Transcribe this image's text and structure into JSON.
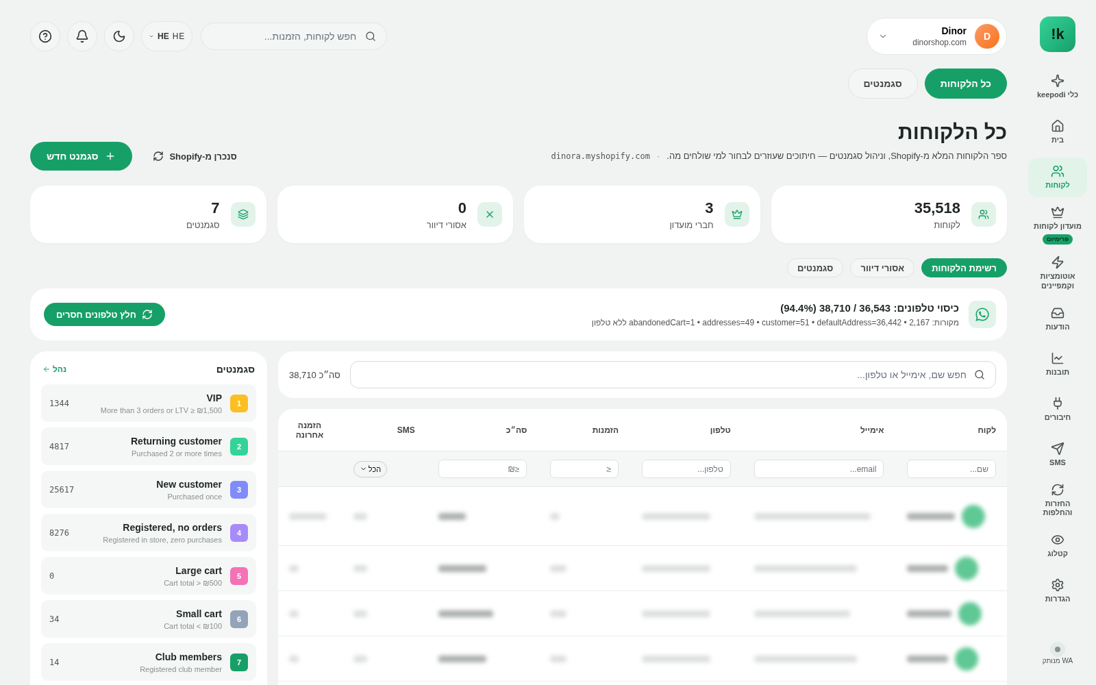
{
  "sidebar": {
    "logo": "!k",
    "items": [
      {
        "label": "כלי keepodi",
        "selected": false
      },
      {
        "label": "בית",
        "selected": false
      },
      {
        "label": "לקוחות",
        "selected": true
      },
      {
        "label": "מועדון לקוחות",
        "selected": false,
        "badge": "פרימיום"
      },
      {
        "label": "אוטומציות וקמפיינים",
        "selected": false
      },
      {
        "label": "הודעות",
        "selected": false
      },
      {
        "label": "תובנות",
        "selected": false
      },
      {
        "label": "חיבורים",
        "selected": false
      },
      {
        "label": "SMS",
        "selected": false
      },
      {
        "label": "החזרות והחלפות",
        "selected": false
      },
      {
        "label": "קטלוג",
        "selected": false
      },
      {
        "label": "הגדרות",
        "selected": false
      }
    ],
    "wa_status": {
      "label": "WA מנותק",
      "connected": false
    }
  },
  "header": {
    "user": {
      "name": "Dinor",
      "domain": "dinorshop.com",
      "initial": "D"
    },
    "search": {
      "placeholder": "חפש לקוחות, הזמנות..."
    },
    "language": {
      "code": "HE",
      "label": "HE"
    }
  },
  "view_tabs": [
    {
      "label": "כל הלקוחות",
      "selected": true
    },
    {
      "label": "סגמנטים",
      "selected": false
    }
  ],
  "page": {
    "title": "כל הלקוחות",
    "subtitle": "ספר הלקוחות המלא מ-Shopify, וניהול סגמנטים — חיתוכים שעוזרים לבחור למי שולחים מה.",
    "separator": "·",
    "store": "dinora.myshopify.com",
    "sync_label": "סנכרן מ-Shopify",
    "new_button": "סגמנט חדש"
  },
  "stats": [
    {
      "value": "35,518",
      "label": "לקוחות"
    },
    {
      "value": "3",
      "label": "חברי מועדון"
    },
    {
      "value": "0",
      "label": "אסורי דיוור"
    },
    {
      "value": "7",
      "label": "סגמנטים"
    }
  ],
  "sub_tabs": [
    {
      "label": "רשימת הלקוחות",
      "selected": true
    },
    {
      "label": "אסורי דיוור",
      "selected": false
    },
    {
      "label": "סגמנטים",
      "selected": false
    }
  ],
  "phone_coverage": {
    "title": "כיסוי טלפונים: 36,543 / 38,710 (94.4%)",
    "sources": "מקורות: abandonedCart=1 • addresses=49 • customer=51 • defaultAddress=36,442 • 2,167 ללא טלפון",
    "button": "חלץ טלפונים חסרים"
  },
  "table": {
    "search": {
      "placeholder": "חפש שם, אימייל או טלפון..."
    },
    "total": "סה״כ 38,710",
    "columns": [
      "לקוח",
      "אימייל",
      "טלפון",
      "הזמנות",
      "סה״כ",
      "SMS",
      "הזמנה אחרונה"
    ],
    "filters": [
      {
        "kind": "input",
        "placeholder": "שם..."
      },
      {
        "kind": "input",
        "placeholder": "email..."
      },
      {
        "kind": "input",
        "placeholder": "טלפון..."
      },
      {
        "kind": "input",
        "placeholder": "≤"
      },
      {
        "kind": "input",
        "placeholder": "≤₪"
      },
      {
        "kind": "select",
        "value": "הכל"
      },
      {
        "kind": "none"
      }
    ],
    "rows": [
      {
        "kind": "blurred"
      },
      {
        "kind": "blurred"
      },
      {
        "kind": "blurred"
      },
      {
        "kind": "blurred"
      }
    ]
  },
  "segments": {
    "title": "סגמנטים",
    "manage": "נהל",
    "items": [
      {
        "number": "1",
        "color": "#fbbf24",
        "name": "VIP",
        "description": "More than 3 orders or LTV ≥ ₪1,500",
        "count": "1344"
      },
      {
        "number": "2",
        "color": "#34d399",
        "name": "Returning customer",
        "description": "Purchased 2 or more times",
        "count": "4817"
      },
      {
        "number": "3",
        "color": "#818cf8",
        "name": "New customer",
        "description": "Purchased once",
        "count": "25617"
      },
      {
        "number": "4",
        "color": "#a78bfa",
        "name": "Registered, no orders",
        "description": "Registered in store, zero purchases",
        "count": "8276"
      },
      {
        "number": "5",
        "color": "#f472b6",
        "name": "Large cart",
        "description": "Cart total > ₪500",
        "count": "0"
      },
      {
        "number": "6",
        "color": "#94a3b8",
        "name": "Small cart",
        "description": "Cart total < ₪100",
        "count": "34"
      },
      {
        "number": "7",
        "color": "#16a068",
        "name": "Club members",
        "description": "Registered club member",
        "count": "14"
      }
    ]
  }
}
